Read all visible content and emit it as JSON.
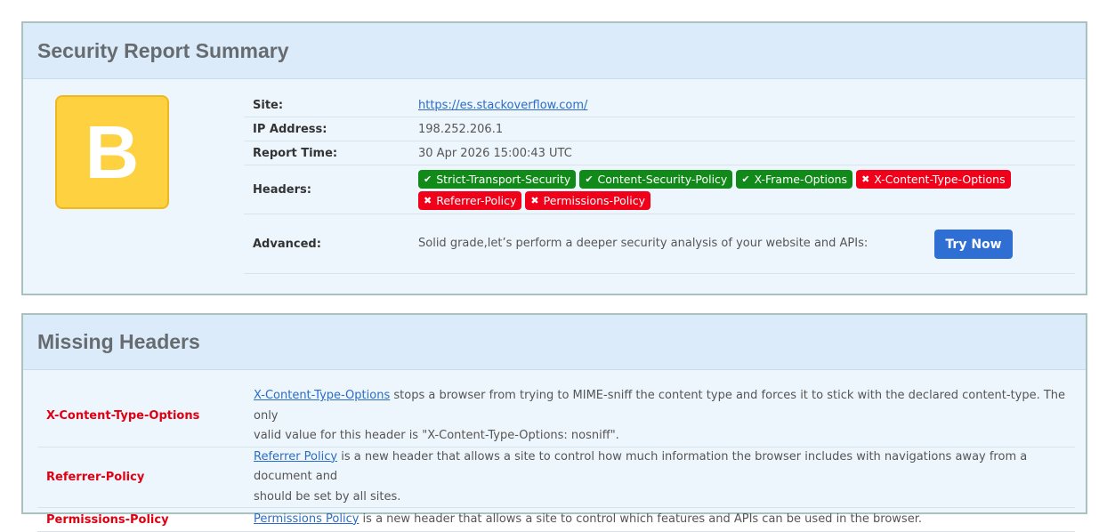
{
  "summary": {
    "title": "Security Report Summary",
    "grade": "B",
    "grade_color": "#fed140",
    "labels": {
      "site": "Site:",
      "ip": "IP Address:",
      "time": "Report Time:",
      "headers": "Headers:",
      "advanced": "Advanced:"
    },
    "site_url": "https://es.stackoverflow.com/",
    "ip": "198.252.206.1",
    "report_time": "30 Apr 2026 15:00:43 UTC",
    "headers": [
      {
        "name": "Strict-Transport-Security",
        "status": "present",
        "icon": "check-icon"
      },
      {
        "name": "Content-Security-Policy",
        "status": "present",
        "icon": "check-icon"
      },
      {
        "name": "X-Frame-Options",
        "status": "present",
        "icon": "check-icon"
      },
      {
        "name": "X-Content-Type-Options",
        "status": "missing",
        "icon": "cross-icon"
      },
      {
        "name": "Referrer-Policy",
        "status": "missing",
        "icon": "cross-icon"
      },
      {
        "name": "Permissions-Policy",
        "status": "missing",
        "icon": "cross-icon"
      }
    ],
    "advanced_text": "Solid grade,let’s perform a deeper security analysis of your website and APIs:",
    "try_button": "Try Now"
  },
  "missing": {
    "title": "Missing Headers",
    "items": [
      {
        "name": "X-Content-Type-Options",
        "link": "X-Content-Type-Options",
        "desc1": " stops a browser from trying to MIME-sniff the content type and forces it to stick with the declared content-type. The only",
        "desc2": "valid value for this header is \"X-Content-Type-Options: nosniff\"."
      },
      {
        "name": "Referrer-Policy",
        "link": "Referrer Policy",
        "desc1": " is a new header that allows a site to control how much information the browser includes with navigations away from a document and",
        "desc2": "should be set by all sites."
      },
      {
        "name": "Permissions-Policy",
        "link": "Permissions Policy",
        "desc1": " is a new header that allows a site to control which features and APIs can be used in the browser.",
        "desc2": ""
      }
    ]
  },
  "colors": {
    "present": "#118a1a",
    "missing": "#f1001a",
    "link": "#2b6cc4",
    "button": "#2f6fd4"
  }
}
